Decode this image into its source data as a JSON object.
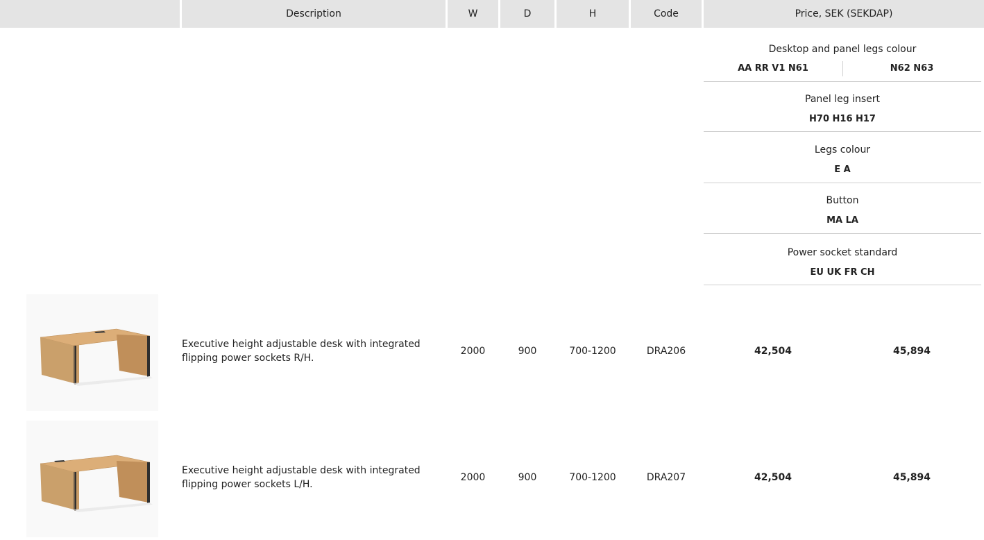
{
  "header": {
    "description": "Description",
    "w": "W",
    "d": "D",
    "h": "H",
    "code": "Code",
    "price": "Price, SEK (SEKDAP)"
  },
  "options": {
    "desktop_colour": {
      "title": "Desktop and panel legs colour",
      "group1": "AA RR V1 N61",
      "group2": "N62 N63"
    },
    "panel_leg_insert": {
      "title": "Panel leg insert",
      "values": "H70 H16 H17"
    },
    "legs_colour": {
      "title": "Legs colour",
      "values": "E A"
    },
    "button": {
      "title": "Button",
      "values": "MA LA"
    },
    "power_socket": {
      "title": "Power socket standard",
      "values": "EU UK FR CH"
    }
  },
  "products": [
    {
      "description": "Executive height adjustable desk with integrated flipping power sockets R/H.",
      "w": "2000",
      "d": "900",
      "h": "700-1200",
      "code": "DRA206",
      "price1": "42,504",
      "price2": "45,894"
    },
    {
      "description": "Executive height adjustable desk with integrated flipping power sockets L/H.",
      "w": "2000",
      "d": "900",
      "h": "700-1200",
      "code": "DRA207",
      "price1": "42,504",
      "price2": "45,894"
    }
  ]
}
